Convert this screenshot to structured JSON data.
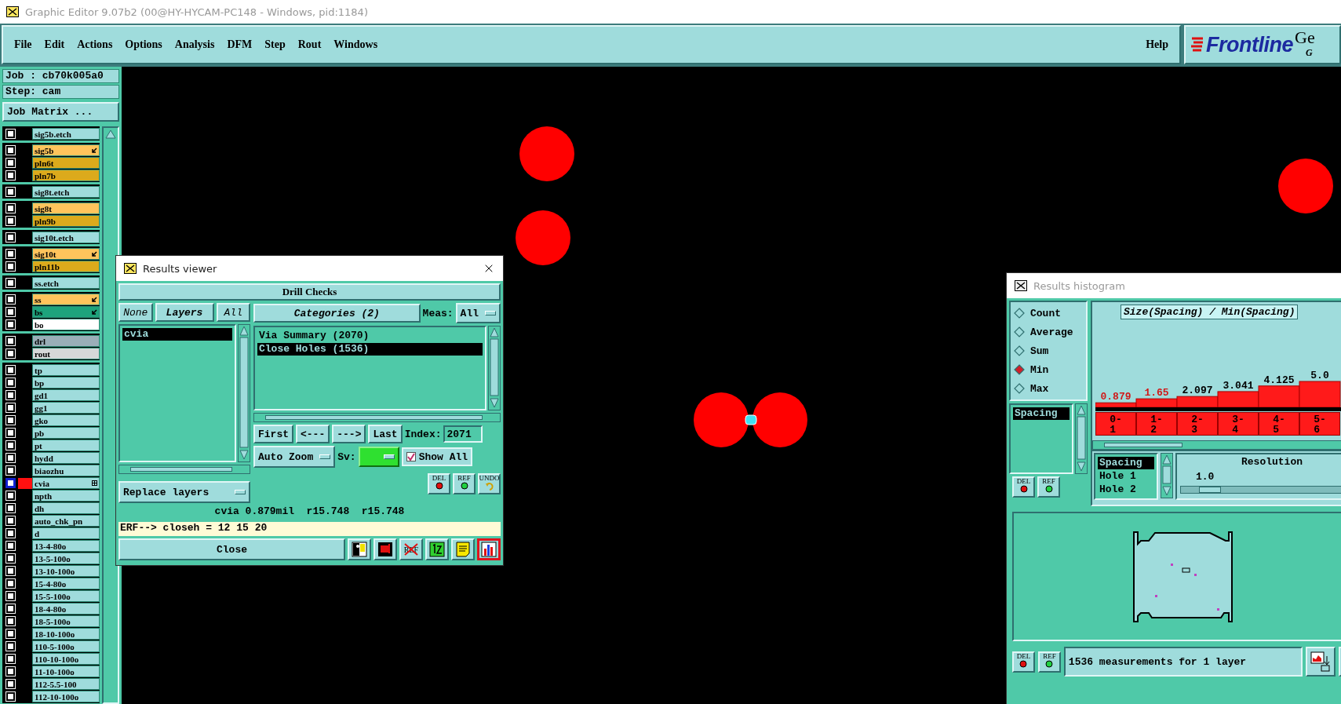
{
  "window": {
    "title": "Graphic Editor 9.07b2 (00@HY-HYCAM-PC148 - Windows, pid:1184)"
  },
  "menu": {
    "items": [
      "File",
      "Edit",
      "Actions",
      "Options",
      "Analysis",
      "DFM",
      "Step",
      "Rout",
      "Windows"
    ],
    "help": "Help"
  },
  "logo": {
    "brand": "Frontline",
    "title_fragment": "Ge",
    "subtitle_fragment": "G"
  },
  "job_panel": {
    "job": "Job : cb70k005a0",
    "step": "Step: cam",
    "matrix_button": "Job Matrix ..."
  },
  "layer_groups": [
    {
      "layers": [
        {
          "name": "sig5b.etch",
          "color": "#9fdcdc",
          "arrow": false,
          "grid": false,
          "checked": false,
          "displayed": false
        }
      ]
    },
    {
      "layers": [
        {
          "name": "sig5b",
          "color": "#ffc45c",
          "arrow": true,
          "grid": false,
          "checked": false,
          "displayed": false
        },
        {
          "name": "pln6t",
          "color": "#dcaa1c",
          "arrow": false,
          "grid": false,
          "checked": false,
          "displayed": false
        },
        {
          "name": "pln7b",
          "color": "#dcaa1c",
          "arrow": false,
          "grid": false,
          "checked": false,
          "displayed": false
        }
      ]
    },
    {
      "layers": [
        {
          "name": "sig8t.etch",
          "color": "#9fdcdc",
          "arrow": false,
          "grid": false,
          "checked": false,
          "displayed": false
        }
      ]
    },
    {
      "layers": [
        {
          "name": "sig8t",
          "color": "#ffc45c",
          "arrow": false,
          "grid": false,
          "checked": false,
          "displayed": false
        },
        {
          "name": "pln9b",
          "color": "#dcaa1c",
          "arrow": false,
          "grid": false,
          "checked": false,
          "displayed": false
        }
      ]
    },
    {
      "layers": [
        {
          "name": "sig10t.etch",
          "color": "#9fdcdc",
          "arrow": false,
          "grid": false,
          "checked": false,
          "displayed": false
        }
      ]
    },
    {
      "layers": [
        {
          "name": "sig10t",
          "color": "#ffc45c",
          "arrow": true,
          "grid": false,
          "checked": false,
          "displayed": false
        },
        {
          "name": "pln11b",
          "color": "#dcaa1c",
          "arrow": false,
          "grid": false,
          "checked": false,
          "displayed": false
        }
      ]
    },
    {
      "layers": [
        {
          "name": "ss.etch",
          "color": "#9fdcdc",
          "arrow": false,
          "grid": false,
          "checked": false,
          "displayed": false
        }
      ]
    },
    {
      "layers": [
        {
          "name": "ss",
          "color": "#ffc45c",
          "arrow": true,
          "grid": false,
          "checked": false,
          "displayed": false
        },
        {
          "name": "bs",
          "color": "#1ea37c",
          "arrow": true,
          "grid": false,
          "checked": false,
          "displayed": false
        },
        {
          "name": "bo",
          "color": "#ffffff",
          "arrow": false,
          "grid": false,
          "checked": false,
          "displayed": false
        }
      ]
    },
    {
      "layers": [
        {
          "name": "drl",
          "color": "#9aaeb8",
          "arrow": false,
          "grid": false,
          "checked": false,
          "displayed": false
        },
        {
          "name": "rout",
          "color": "#d6d8d8",
          "arrow": false,
          "grid": false,
          "checked": false,
          "displayed": false
        }
      ]
    },
    {
      "layers": [
        {
          "name": "tp",
          "color": "#9fdcdc",
          "arrow": false,
          "grid": false,
          "checked": false,
          "displayed": false
        },
        {
          "name": "bp",
          "color": "#9fdcdc",
          "arrow": false,
          "grid": false,
          "checked": false,
          "displayed": false
        },
        {
          "name": "gd1",
          "color": "#9fdcdc",
          "arrow": false,
          "grid": false,
          "checked": false,
          "displayed": false
        },
        {
          "name": "gg1",
          "color": "#9fdcdc",
          "arrow": false,
          "grid": false,
          "checked": false,
          "displayed": false
        },
        {
          "name": "gko",
          "color": "#9fdcdc",
          "arrow": false,
          "grid": false,
          "checked": false,
          "displayed": false
        },
        {
          "name": "pb",
          "color": "#9fdcdc",
          "arrow": false,
          "grid": false,
          "checked": false,
          "displayed": false
        },
        {
          "name": "pt",
          "color": "#9fdcdc",
          "arrow": false,
          "grid": false,
          "checked": false,
          "displayed": false
        },
        {
          "name": "hydd",
          "color": "#9fdcdc",
          "arrow": false,
          "grid": false,
          "checked": false,
          "displayed": false
        },
        {
          "name": "biaozhu",
          "color": "#9fdcdc",
          "arrow": false,
          "grid": false,
          "checked": false,
          "displayed": false
        },
        {
          "name": "cvia",
          "color": "#9fdcdc",
          "arrow": false,
          "grid": true,
          "checked": false,
          "displayed": true
        },
        {
          "name": "npth",
          "color": "#9fdcdc",
          "arrow": false,
          "grid": false,
          "checked": false,
          "displayed": false
        },
        {
          "name": "dh",
          "color": "#9fdcdc",
          "arrow": false,
          "grid": false,
          "checked": false,
          "displayed": false
        },
        {
          "name": "auto_chk_pn",
          "color": "#9fdcdc",
          "arrow": false,
          "grid": false,
          "checked": false,
          "displayed": false
        },
        {
          "name": "d",
          "color": "#9fdcdc",
          "arrow": false,
          "grid": false,
          "checked": false,
          "displayed": false
        },
        {
          "name": "13-4-80o",
          "color": "#9fdcdc",
          "arrow": false,
          "grid": false,
          "checked": false,
          "displayed": false
        },
        {
          "name": "13-5-100o",
          "color": "#9fdcdc",
          "arrow": false,
          "grid": false,
          "checked": false,
          "displayed": false
        },
        {
          "name": "13-10-100o",
          "color": "#9fdcdc",
          "arrow": false,
          "grid": false,
          "checked": false,
          "displayed": false
        },
        {
          "name": "15-4-80o",
          "color": "#9fdcdc",
          "arrow": false,
          "grid": false,
          "checked": false,
          "displayed": false
        },
        {
          "name": "15-5-100o",
          "color": "#9fdcdc",
          "arrow": false,
          "grid": false,
          "checked": false,
          "displayed": false
        },
        {
          "name": "18-4-80o",
          "color": "#9fdcdc",
          "arrow": false,
          "grid": false,
          "checked": false,
          "displayed": false
        },
        {
          "name": "18-5-100o",
          "color": "#9fdcdc",
          "arrow": false,
          "grid": false,
          "checked": false,
          "displayed": false
        },
        {
          "name": "18-10-100o",
          "color": "#9fdcdc",
          "arrow": false,
          "grid": false,
          "checked": false,
          "displayed": false
        },
        {
          "name": "110-5-100o",
          "color": "#9fdcdc",
          "arrow": false,
          "grid": false,
          "checked": false,
          "displayed": false
        },
        {
          "name": "110-10-100o",
          "color": "#9fdcdc",
          "arrow": false,
          "grid": false,
          "checked": false,
          "displayed": false
        },
        {
          "name": "11-10-100o",
          "color": "#9fdcdc",
          "arrow": false,
          "grid": false,
          "checked": false,
          "displayed": false
        },
        {
          "name": "112-5.5-100",
          "color": "#9fdcdc",
          "arrow": false,
          "grid": false,
          "checked": false,
          "displayed": false
        },
        {
          "name": "112-10-100o",
          "color": "#9fdcdc",
          "arrow": false,
          "grid": false,
          "checked": false,
          "displayed": false
        }
      ]
    }
  ],
  "results_viewer": {
    "title": "Results viewer",
    "heading": "Drill Checks",
    "layer_buttons": [
      {
        "label": "None",
        "selected": false
      },
      {
        "label": "Layers",
        "selected": true
      },
      {
        "label": "All",
        "selected": false
      }
    ],
    "layers": [
      {
        "name": "cvia",
        "selected": true
      }
    ],
    "replace_button": "Replace layers",
    "categories_button": "Categories (2)",
    "meas_label": "Meas:",
    "meas_value": "All",
    "categories": [
      {
        "name": "Via Summary (2070)",
        "selected": false
      },
      {
        "name": "Close Holes (1536)",
        "selected": true
      }
    ],
    "nav": [
      "First",
      "<---",
      "--->",
      "Last"
    ],
    "index_label": "Index:",
    "index_value": "2071",
    "zoom_mode": "Auto Zoom",
    "sv_label": "Sv:",
    "show_all": {
      "label": "Show All",
      "checked": true
    },
    "tools": [
      {
        "label": "DEL",
        "kind": "del"
      },
      {
        "label": "REF",
        "kind": "ref"
      },
      {
        "label": "UNDO",
        "kind": "undo"
      }
    ],
    "measurement": "cvia 0.879mil  r15.748  r15.748",
    "erf": "ERF--> closeh = 12 15 20",
    "close": "Close",
    "actions": [
      {
        "kind": "figure",
        "selected": false
      },
      {
        "kind": "stop",
        "selected": false
      },
      {
        "kind": "crossed",
        "label": "REF",
        "selected": false
      },
      {
        "kind": "list",
        "selected": false
      },
      {
        "kind": "note",
        "selected": false
      },
      {
        "kind": "chart",
        "selected": true
      }
    ]
  },
  "histogram": {
    "title": "Results histogram",
    "modes": [
      {
        "label": "Count",
        "selected": false
      },
      {
        "label": "Average",
        "selected": false
      },
      {
        "label": "Sum",
        "selected": false
      },
      {
        "label": "Min",
        "selected": true
      },
      {
        "label": "Max",
        "selected": false
      }
    ],
    "measures": [
      {
        "name": "Spacing",
        "selected": true
      }
    ],
    "tools": [
      {
        "label": "DEL",
        "kind": "del"
      },
      {
        "label": "REF",
        "kind": "ref"
      }
    ],
    "chart_data": {
      "type": "bar",
      "title": "Size(Spacing) / Min(Spacing)",
      "categories": [
        "0-1",
        "1-2",
        "2-3",
        "3-4",
        "4-5",
        "5-6"
      ],
      "values": [
        0.879,
        1.65,
        2.097,
        3.041,
        4.125,
        5.0
      ],
      "value_labels": [
        "0.879",
        "1.65",
        "2.097",
        "3.041",
        "4.125",
        "5.0"
      ]
    },
    "fields": [
      {
        "name": "Spacing",
        "selected": true
      },
      {
        "name": "Hole 1",
        "selected": false
      },
      {
        "name": "Hole 2",
        "selected": false
      }
    ],
    "resolution": {
      "label": "Resolution",
      "value": "1.0",
      "level": 0.1
    },
    "bottom_tools": [
      {
        "label": "DEL",
        "kind": "del"
      },
      {
        "label": "REF",
        "kind": "ref"
      }
    ],
    "status": "1536 measurements for 1 layer"
  }
}
